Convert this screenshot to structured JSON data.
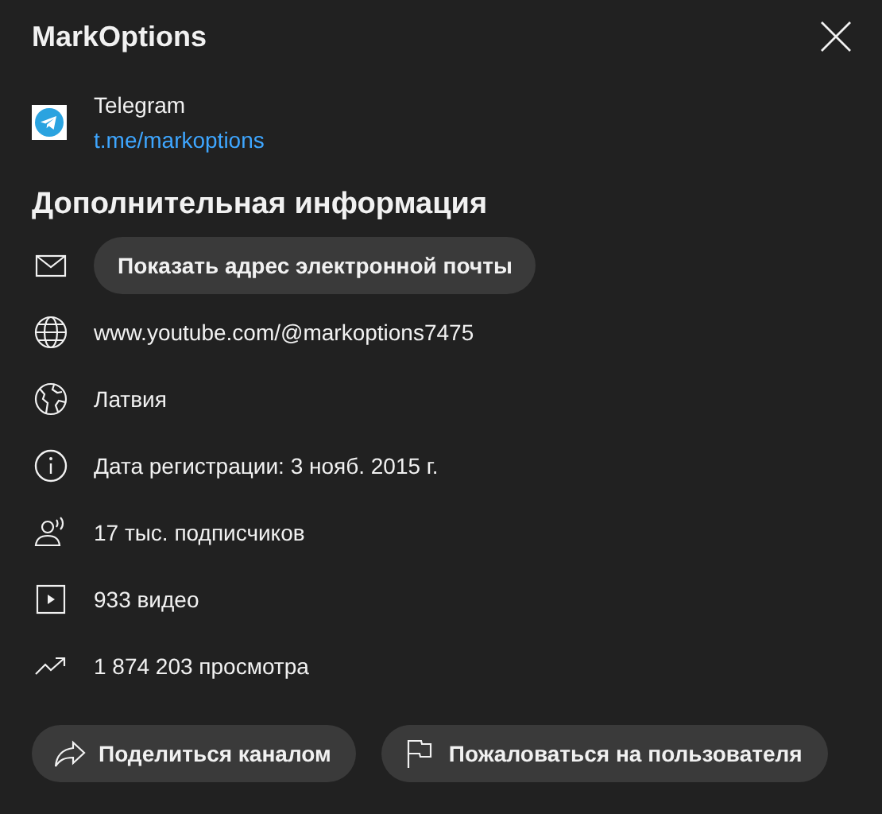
{
  "title": "MarkOptions",
  "links": [
    {
      "name": "Telegram",
      "url": "t.me/markoptions"
    }
  ],
  "section_title": "Дополнительная информация",
  "details": [
    {
      "kind": "email",
      "text": "Показать адрес электронной почты"
    },
    {
      "kind": "link",
      "text": "www.youtube.com/@markoptions7475"
    },
    {
      "kind": "country",
      "text": "Латвия"
    },
    {
      "kind": "joined",
      "text": "Дата регистрации: 3 нояб. 2015 г."
    },
    {
      "kind": "subscribers",
      "text": "17 тыс. подписчиков"
    },
    {
      "kind": "videos",
      "text": "933 видео"
    },
    {
      "kind": "views",
      "text": "1 874 203 просмотра"
    }
  ],
  "actions": [
    {
      "kind": "share",
      "label": "Поделиться каналом"
    },
    {
      "kind": "report",
      "label": "Пожаловаться на пользователя"
    }
  ]
}
